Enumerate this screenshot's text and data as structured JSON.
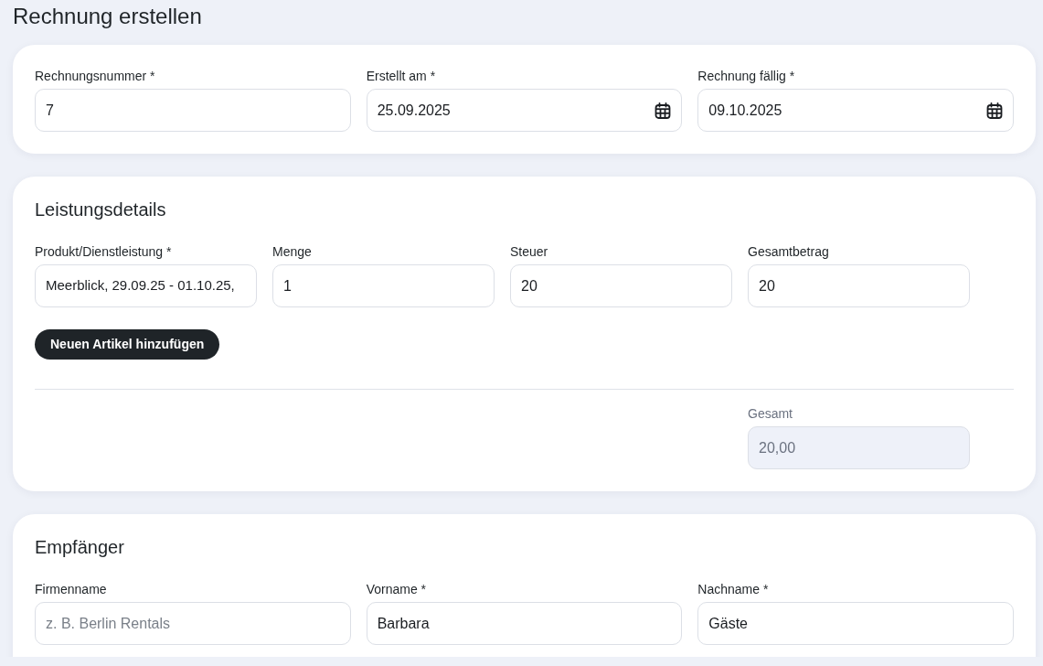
{
  "page_title": "Rechnung erstellen",
  "invoice_card": {
    "fields": [
      {
        "label": "Rechnungsnummer *",
        "value": "7",
        "kind": "text"
      },
      {
        "label": "Erstellt am *",
        "value": "25.09.2025",
        "kind": "date"
      },
      {
        "label": "Rechnung fällig *",
        "value": "09.10.2025",
        "kind": "date"
      }
    ]
  },
  "service_details": {
    "heading": "Leistungsdetails",
    "fields": [
      {
        "label": "Produkt/Dienstleistung *",
        "value": "Meerblick, 29.09.25 - 01.10.25,"
      },
      {
        "label": "Menge",
        "value": "1"
      },
      {
        "label": "Steuer",
        "value": "20"
      },
      {
        "label": "Gesamtbetrag",
        "value": "20"
      }
    ],
    "add_button": "Neuen Artikel hinzufügen",
    "total": {
      "label": "Gesamt",
      "value": "20,00",
      "disabled": true
    }
  },
  "recipient": {
    "heading": "Empfänger",
    "fields": [
      {
        "label": "Firmenname",
        "placeholder": "z. B. Berlin Rentals"
      },
      {
        "label": "Vorname *",
        "value": "Barbara"
      },
      {
        "label": "Nachname *",
        "value": "Gäste"
      }
    ]
  }
}
